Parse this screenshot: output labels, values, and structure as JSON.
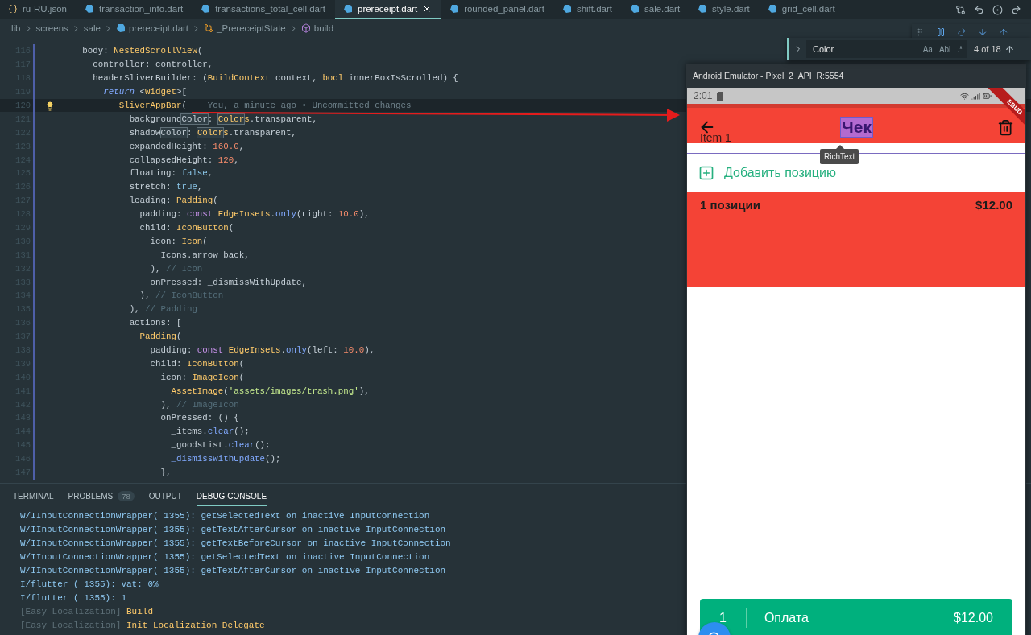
{
  "tabs": [
    {
      "label": "ru-RU.json",
      "kind": "json",
      "selected": false
    },
    {
      "label": "transaction_info.dart",
      "kind": "dart",
      "selected": false
    },
    {
      "label": "transactions_total_cell.dart",
      "kind": "dart",
      "selected": false
    },
    {
      "label": "prereceipt.dart",
      "kind": "dart",
      "selected": true
    },
    {
      "label": "rounded_panel.dart",
      "kind": "dart",
      "selected": false
    },
    {
      "label": "shift.dart",
      "kind": "dart",
      "selected": false
    },
    {
      "label": "sale.dart",
      "kind": "dart",
      "selected": false
    },
    {
      "label": "style.dart",
      "kind": "dart",
      "selected": false
    },
    {
      "label": "grid_cell.dart",
      "kind": "dart",
      "selected": false
    }
  ],
  "breadcrumb": [
    {
      "label": "lib",
      "kind": "folder"
    },
    {
      "label": "screens",
      "kind": "folder"
    },
    {
      "label": "sale",
      "kind": "folder"
    },
    {
      "label": "prereceipt.dart",
      "kind": "file"
    },
    {
      "label": "_PrereceiptState",
      "kind": "class"
    },
    {
      "label": "build",
      "kind": "method"
    }
  ],
  "code": {
    "lines": [
      {
        "number": "116",
        "current": false,
        "segments": [
          {
            "kind": "plain",
            "text": "         body: "
          },
          {
            "kind": "type",
            "text": "NestedScrollView"
          },
          {
            "kind": "plain",
            "text": "("
          }
        ]
      },
      {
        "number": "117",
        "current": false,
        "segments": [
          {
            "kind": "plain",
            "text": "           controller: controller,"
          }
        ]
      },
      {
        "number": "118",
        "current": false,
        "segments": [
          {
            "kind": "plain",
            "text": "           headerSliverBuilder: ("
          },
          {
            "kind": "type",
            "text": "BuildContext"
          },
          {
            "kind": "plain",
            "text": " context, "
          },
          {
            "kind": "type",
            "text": "bool"
          },
          {
            "kind": "plain",
            "text": " innerBoxIsScrolled) {"
          }
        ]
      },
      {
        "number": "119",
        "current": false,
        "segments": [
          {
            "kind": "keyword",
            "text": "             return"
          },
          {
            "kind": "plain",
            "text": " <"
          },
          {
            "kind": "type",
            "text": "Widget"
          },
          {
            "kind": "plain",
            "text": ">["
          }
        ]
      },
      {
        "number": "120",
        "current": true,
        "blame": "You, a minute ago • Uncommitted changes",
        "segments": [
          {
            "kind": "type",
            "text": "                SliverAppBar"
          },
          {
            "kind": "plain",
            "text": "("
          }
        ]
      },
      {
        "number": "121",
        "current": false,
        "segments": [
          {
            "kind": "plain",
            "text": "                  background"
          },
          {
            "kind": "match",
            "text": "Color"
          },
          {
            "kind": "plain",
            "text": ": "
          },
          {
            "kind": "typematch",
            "text": "Color"
          },
          {
            "kind": "type",
            "text": "s"
          },
          {
            "kind": "plain",
            "text": ".transparent,"
          }
        ]
      },
      {
        "number": "122",
        "current": false,
        "segments": [
          {
            "kind": "plain",
            "text": "                  shadow"
          },
          {
            "kind": "match",
            "text": "Color"
          },
          {
            "kind": "plain",
            "text": ": "
          },
          {
            "kind": "typematch",
            "text": "Color"
          },
          {
            "kind": "type",
            "text": "s"
          },
          {
            "kind": "plain",
            "text": ".transparent,"
          }
        ]
      },
      {
        "number": "123",
        "current": false,
        "segments": [
          {
            "kind": "plain",
            "text": "                  expandedHeight: "
          },
          {
            "kind": "number",
            "text": "160.0"
          },
          {
            "kind": "plain",
            "text": ","
          }
        ]
      },
      {
        "number": "124",
        "current": false,
        "segments": [
          {
            "kind": "plain",
            "text": "                  collapsedHeight: "
          },
          {
            "kind": "number",
            "text": "120"
          },
          {
            "kind": "plain",
            "text": ","
          }
        ]
      },
      {
        "number": "125",
        "current": false,
        "segments": [
          {
            "kind": "plain",
            "text": "                  floating: "
          },
          {
            "kind": "bool",
            "text": "false"
          },
          {
            "kind": "plain",
            "text": ","
          }
        ]
      },
      {
        "number": "126",
        "current": false,
        "segments": [
          {
            "kind": "plain",
            "text": "                  stretch: "
          },
          {
            "kind": "bool",
            "text": "true"
          },
          {
            "kind": "plain",
            "text": ","
          }
        ]
      },
      {
        "number": "127",
        "current": false,
        "segments": [
          {
            "kind": "plain",
            "text": "                  leading: "
          },
          {
            "kind": "type",
            "text": "Padding"
          },
          {
            "kind": "plain",
            "text": "("
          }
        ]
      },
      {
        "number": "128",
        "current": false,
        "segments": [
          {
            "kind": "plain",
            "text": "                    padding: "
          },
          {
            "kind": "storage",
            "text": "const "
          },
          {
            "kind": "type",
            "text": "EdgeInsets"
          },
          {
            "kind": "plain",
            "text": "."
          },
          {
            "kind": "method",
            "text": "only"
          },
          {
            "kind": "plain",
            "text": "(right: "
          },
          {
            "kind": "number",
            "text": "10.0"
          },
          {
            "kind": "plain",
            "text": "),"
          }
        ]
      },
      {
        "number": "129",
        "current": false,
        "segments": [
          {
            "kind": "plain",
            "text": "                    child: "
          },
          {
            "kind": "type",
            "text": "IconButton"
          },
          {
            "kind": "plain",
            "text": "("
          }
        ]
      },
      {
        "number": "130",
        "current": false,
        "segments": [
          {
            "kind": "plain",
            "text": "                      icon: "
          },
          {
            "kind": "type",
            "text": "Icon"
          },
          {
            "kind": "plain",
            "text": "("
          }
        ]
      },
      {
        "number": "131",
        "current": false,
        "segments": [
          {
            "kind": "plain",
            "text": "                        Icons.arrow_back,"
          }
        ]
      },
      {
        "number": "132",
        "current": false,
        "segments": [
          {
            "kind": "plain",
            "text": "                      ), "
          },
          {
            "kind": "comment",
            "text": "// Icon"
          }
        ]
      },
      {
        "number": "133",
        "current": false,
        "segments": [
          {
            "kind": "plain",
            "text": "                      onPressed: _dismissWithUpdate,"
          }
        ]
      },
      {
        "number": "134",
        "current": false,
        "segments": [
          {
            "kind": "plain",
            "text": "                    ), "
          },
          {
            "kind": "comment",
            "text": "// IconButton"
          }
        ]
      },
      {
        "number": "135",
        "current": false,
        "segments": [
          {
            "kind": "plain",
            "text": "                  ), "
          },
          {
            "kind": "comment",
            "text": "// Padding"
          }
        ]
      },
      {
        "number": "136",
        "current": false,
        "segments": [
          {
            "kind": "plain",
            "text": "                  actions: ["
          }
        ]
      },
      {
        "number": "137",
        "current": false,
        "segments": [
          {
            "kind": "type",
            "text": "                    Padding"
          },
          {
            "kind": "plain",
            "text": "("
          }
        ]
      },
      {
        "number": "138",
        "current": false,
        "segments": [
          {
            "kind": "plain",
            "text": "                      padding: "
          },
          {
            "kind": "storage",
            "text": "const "
          },
          {
            "kind": "type",
            "text": "EdgeInsets"
          },
          {
            "kind": "plain",
            "text": "."
          },
          {
            "kind": "method",
            "text": "only"
          },
          {
            "kind": "plain",
            "text": "(left: "
          },
          {
            "kind": "number",
            "text": "10.0"
          },
          {
            "kind": "plain",
            "text": "),"
          }
        ]
      },
      {
        "number": "139",
        "current": false,
        "segments": [
          {
            "kind": "plain",
            "text": "                      child: "
          },
          {
            "kind": "type",
            "text": "IconButton"
          },
          {
            "kind": "plain",
            "text": "("
          }
        ]
      },
      {
        "number": "140",
        "current": false,
        "segments": [
          {
            "kind": "plain",
            "text": "                        icon: "
          },
          {
            "kind": "type",
            "text": "ImageIcon"
          },
          {
            "kind": "plain",
            "text": "("
          }
        ]
      },
      {
        "number": "141",
        "current": false,
        "segments": [
          {
            "kind": "type",
            "text": "                          AssetImage"
          },
          {
            "kind": "plain",
            "text": "("
          },
          {
            "kind": "string",
            "text": "'assets/images/trash.png'"
          },
          {
            "kind": "plain",
            "text": "),"
          }
        ]
      },
      {
        "number": "142",
        "current": false,
        "segments": [
          {
            "kind": "plain",
            "text": "                        ), "
          },
          {
            "kind": "comment",
            "text": "// ImageIcon"
          }
        ]
      },
      {
        "number": "143",
        "current": false,
        "segments": [
          {
            "kind": "plain",
            "text": "                        onPressed: () {"
          }
        ]
      },
      {
        "number": "144",
        "current": false,
        "segments": [
          {
            "kind": "plain",
            "text": "                          _items."
          },
          {
            "kind": "method",
            "text": "clear"
          },
          {
            "kind": "plain",
            "text": "();"
          }
        ]
      },
      {
        "number": "145",
        "current": false,
        "segments": [
          {
            "kind": "plain",
            "text": "                          _goodsList."
          },
          {
            "kind": "method",
            "text": "clear"
          },
          {
            "kind": "plain",
            "text": "();"
          }
        ]
      },
      {
        "number": "146",
        "current": false,
        "segments": [
          {
            "kind": "method",
            "text": "                          _dismissWithUpdate"
          },
          {
            "kind": "plain",
            "text": "();"
          }
        ]
      },
      {
        "number": "147",
        "current": false,
        "segments": [
          {
            "kind": "plain",
            "text": "                        },"
          }
        ]
      }
    ]
  },
  "find": {
    "query": "Color",
    "options": [
      "Aa",
      "Abl",
      ".*"
    ],
    "count": "4 of 18"
  },
  "panel": {
    "tabs": [
      {
        "label": "TERMINAL",
        "selected": false
      },
      {
        "label": "PROBLEMS",
        "badge": "78",
        "selected": false
      },
      {
        "label": "OUTPUT",
        "selected": false
      },
      {
        "label": "DEBUG CONSOLE",
        "selected": true
      }
    ],
    "console": [
      {
        "kind": "info",
        "text": "W/IInputConnectionWrapper( 1355): getSelectedText on inactive InputConnection"
      },
      {
        "kind": "info",
        "text": "W/IInputConnectionWrapper( 1355): getTextAfterCursor on inactive InputConnection"
      },
      {
        "kind": "info",
        "text": "W/IInputConnectionWrapper( 1355): getTextBeforeCursor on inactive InputConnection"
      },
      {
        "kind": "info",
        "text": "W/IInputConnectionWrapper( 1355): getSelectedText on inactive InputConnection"
      },
      {
        "kind": "info",
        "text": "W/IInputConnectionWrapper( 1355): getTextAfterCursor on inactive InputConnection"
      },
      {
        "kind": "info",
        "text": "I/flutter ( 1355): vat: 0%"
      },
      {
        "kind": "info",
        "text": "I/flutter ( 1355): 1"
      },
      {
        "kind": "tagged",
        "tag": "[Easy Localization]",
        "text": "Build"
      },
      {
        "kind": "tagged",
        "tag": "[Easy Localization]",
        "text": "Init Localization Delegate"
      }
    ]
  },
  "emulator": {
    "title": "Android Emulator - Pixel_2_API_R:5554",
    "time": "2:01",
    "ribbon": "EBUG",
    "app_bar": {
      "title": "Чек",
      "title_selected": true,
      "tooltip": "RichText",
      "item": "Item 1"
    },
    "add_label": "Добавить позицию",
    "summary": {
      "count": "1 позиции",
      "total": "$12.00"
    },
    "pay": {
      "count": "1",
      "label": "Оплата",
      "amount": "$12.00"
    }
  }
}
